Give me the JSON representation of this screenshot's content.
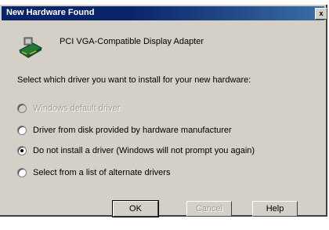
{
  "window": {
    "title": "New Hardware Found",
    "close_label": "x"
  },
  "device": {
    "name": "PCI VGA-Compatible Display Adapter",
    "icon": "hardware-card-icon"
  },
  "prompt": "Select which driver you want to install for your new hardware:",
  "options": [
    {
      "label": "Windows default driver",
      "checked": false,
      "enabled": false
    },
    {
      "label": "Driver from disk provided by hardware manufacturer",
      "checked": false,
      "enabled": true
    },
    {
      "label": "Do not install a driver (Windows will not prompt you again)",
      "checked": true,
      "enabled": true
    },
    {
      "label": "Select from a list of alternate drivers",
      "checked": false,
      "enabled": true
    }
  ],
  "buttons": {
    "ok": "OK",
    "cancel": "Cancel",
    "help": "Help"
  },
  "colors": {
    "title_bar": "#0a246a",
    "dialog_face": "#d4d0c8"
  }
}
